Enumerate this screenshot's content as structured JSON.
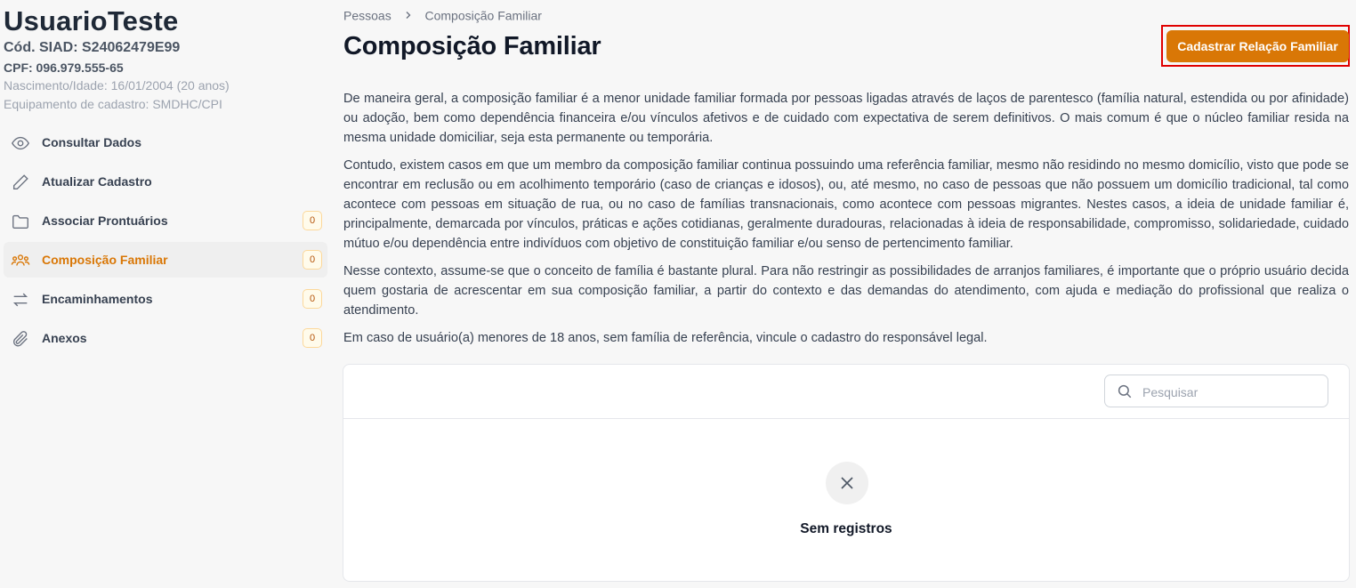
{
  "user": {
    "name": "UsuarioTeste",
    "code": "Cód. SIAD: S24062479E99",
    "cpf": "CPF: 096.979.555-65",
    "birth": "Nascimento/Idade: 16/01/2004 (20 anos)",
    "equipment": "Equipamento de cadastro: SMDHC/CPI"
  },
  "menu": [
    {
      "label": "Consultar Dados",
      "icon": "eye-icon"
    },
    {
      "label": "Atualizar Cadastro",
      "icon": "pencil-icon"
    },
    {
      "label": "Associar Prontuários",
      "icon": "folder-icon",
      "badge": "0"
    },
    {
      "label": "Composição Familiar",
      "icon": "family-icon",
      "badge": "0",
      "active": true
    },
    {
      "label": "Encaminhamentos",
      "icon": "arrows-exchange-icon",
      "badge": "0"
    },
    {
      "label": "Anexos",
      "icon": "paperclip-icon",
      "badge": "0"
    }
  ],
  "breadcrumb": {
    "root": "Pessoas",
    "current": "Composição Familiar"
  },
  "page": {
    "title": "Composição Familiar",
    "primary_button": "Cadastrar Relação Familiar"
  },
  "content": {
    "paragraphs": [
      "De maneira geral, a composição familiar é a menor unidade familiar formada por pessoas ligadas através de laços de parentesco (família natural, estendida ou por afinidade) ou adoção, bem como dependência financeira e/ou vínculos afetivos e de cuidado com expectativa de serem definitivos. O mais comum é que o núcleo familiar resida na mesma unidade domiciliar, seja esta permanente ou temporária.",
      "Contudo, existem casos em que um membro da composição familiar continua possuindo uma referência familiar, mesmo não residindo no mesmo domicílio, visto que pode se encontrar em reclusão ou em acolhimento temporário (caso de crianças e idosos), ou, até mesmo, no caso de pessoas que não possuem um domicílio tradicional, tal como acontece com pessoas em situação de rua, ou no caso de famílias transnacionais, como acontece com pessoas migrantes. Nestes casos, a ideia de unidade familiar é, principalmente, demarcada por vínculos, práticas e ações cotidianas, geralmente duradouras, relacionadas à ideia de responsabilidade, compromisso, solidariedade, cuidado mútuo e/ou dependência entre indivíduos com objetivo de constituição familiar e/ou senso de pertencimento familiar.",
      "Nesse contexto, assume-se que o conceito de família é bastante plural. Para não restringir as possibilidades de arranjos familiares, é importante que o próprio usuário decida quem gostaria de acrescentar em sua composição familiar, a partir do contexto e das demandas do atendimento, com ajuda e mediação do profissional que realiza o atendimento.",
      "Em caso de usuário(a) menores de 18 anos, sem família de referência, vincule o cadastro do responsável legal."
    ]
  },
  "table": {
    "search_placeholder": "Pesquisar",
    "empty_text": "Sem registros"
  },
  "colors": {
    "accent": "#d97706",
    "highlight": "#e00000"
  }
}
